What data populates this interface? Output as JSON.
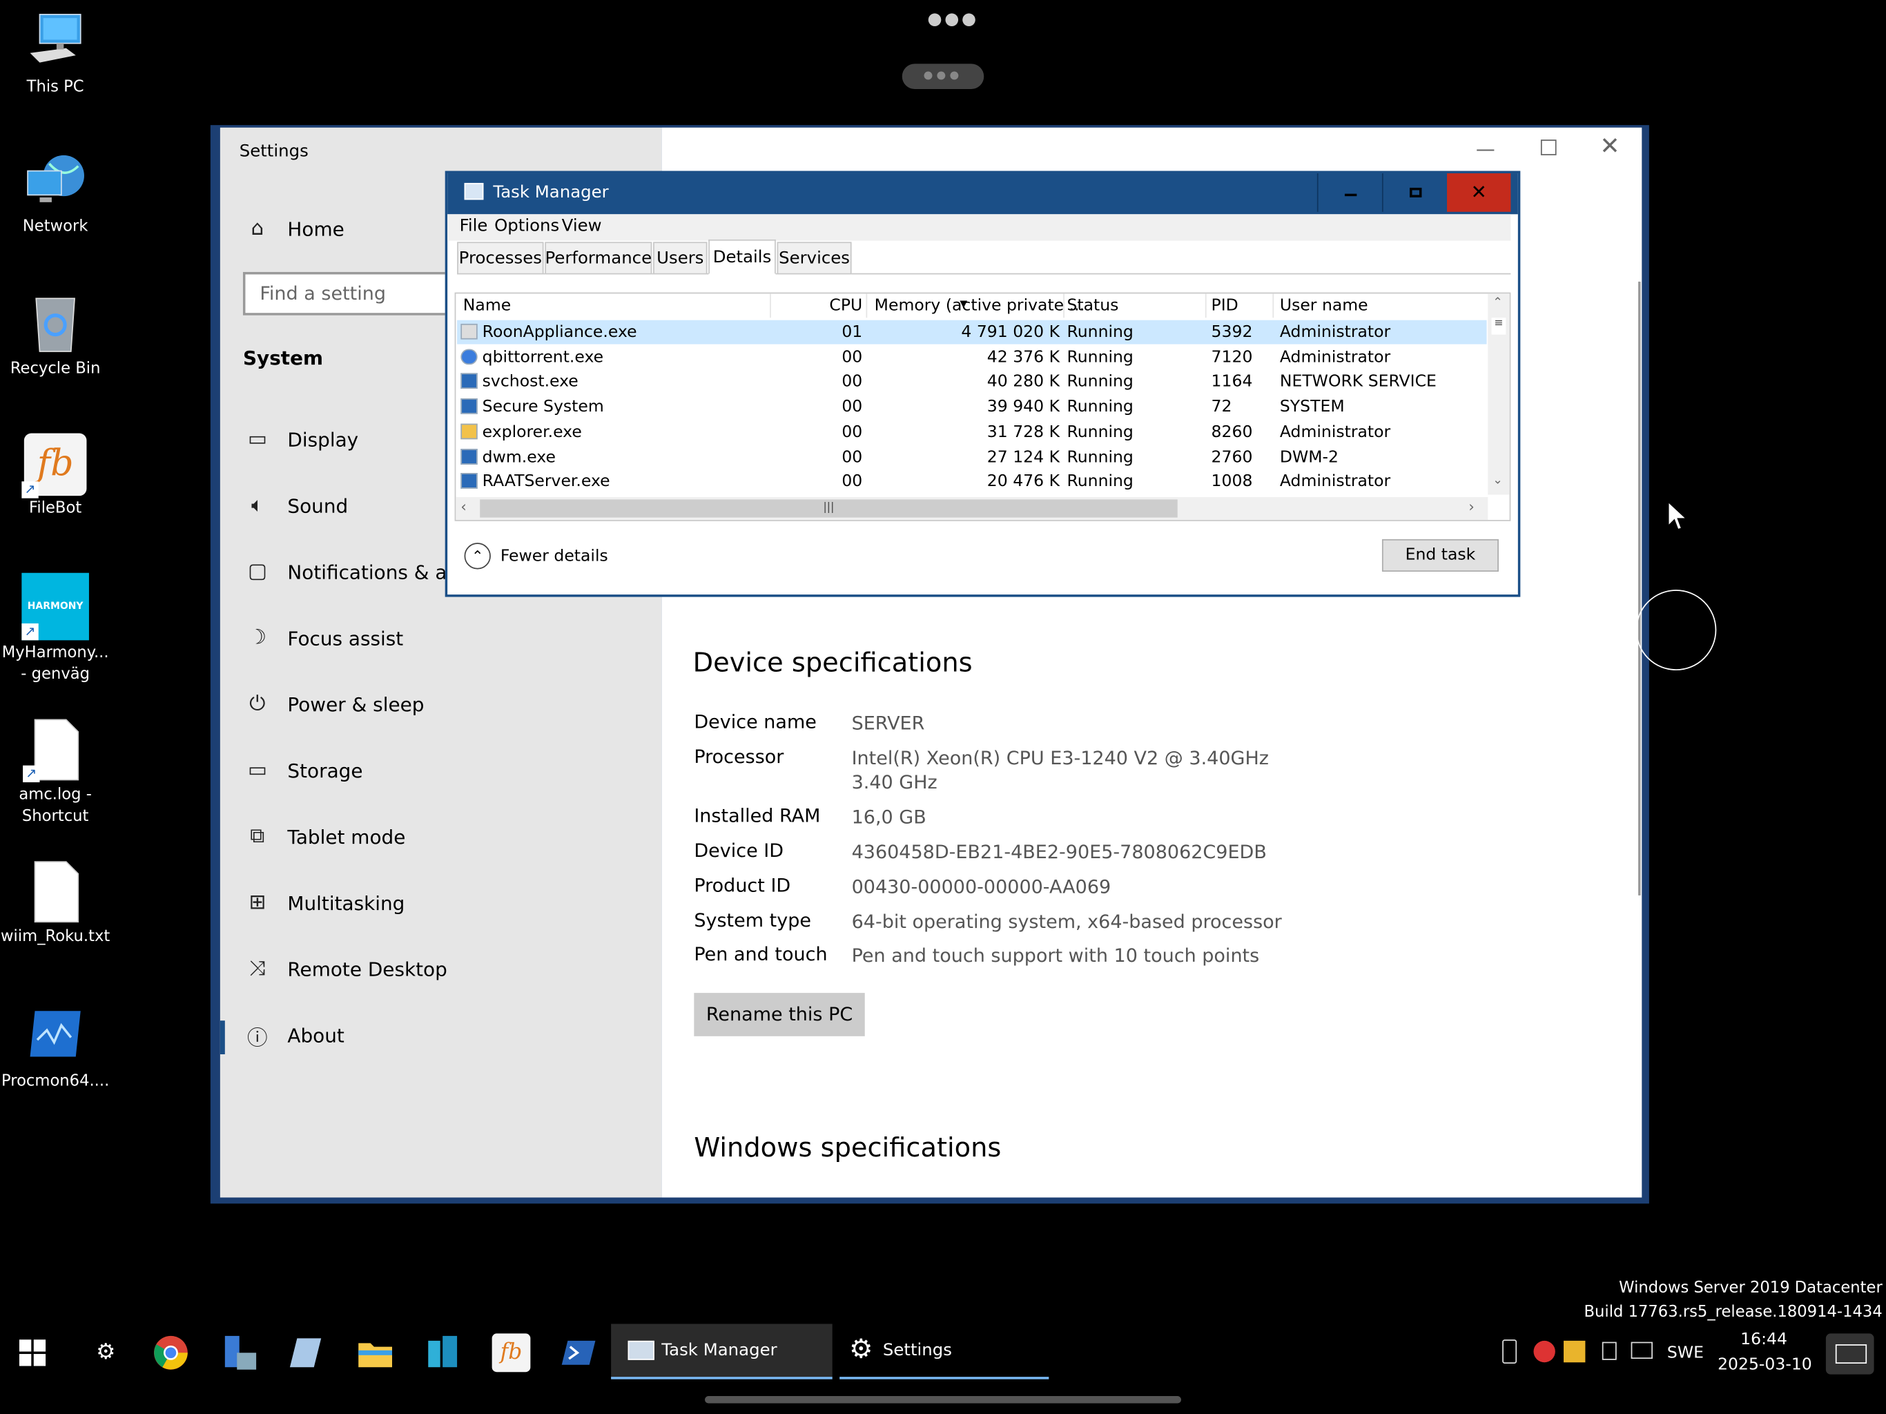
{
  "desktop": {
    "icons": [
      {
        "label_1": "This PC",
        "label_2": "",
        "icon": "this-pc-icon"
      },
      {
        "label_1": "Network",
        "label_2": "",
        "icon": "network-icon"
      },
      {
        "label_1": "Recycle Bin",
        "label_2": "",
        "icon": "recycle-bin-icon"
      },
      {
        "label_1": "FileBot",
        "label_2": "",
        "icon": "filebot-icon"
      },
      {
        "label_1": "MyHarmony...",
        "label_2": "- genväg",
        "icon": "harmony-icon"
      },
      {
        "label_1": "amc.log -",
        "label_2": "Shortcut",
        "icon": "file-shortcut-icon"
      },
      {
        "label_1": "wiim_Roku.txt",
        "label_2": "",
        "icon": "text-file-icon"
      },
      {
        "label_1": "Procmon64....",
        "label_2": "",
        "icon": "procmon-icon"
      }
    ],
    "harmony_text": "HARMONY",
    "filebot_text": "fb"
  },
  "settings": {
    "title": "Settings",
    "home": "Home",
    "search_placeholder": "Find a setting",
    "section": "System",
    "nav": [
      {
        "label": "Display",
        "icon": "display-icon"
      },
      {
        "label": "Sound",
        "icon": "sound-icon"
      },
      {
        "label": "Notifications & acti",
        "icon": "notifications-icon"
      },
      {
        "label": "Focus assist",
        "icon": "focus-assist-icon"
      },
      {
        "label": "Power & sleep",
        "icon": "power-icon"
      },
      {
        "label": "Storage",
        "icon": "storage-icon"
      },
      {
        "label": "Tablet mode",
        "icon": "tablet-mode-icon"
      },
      {
        "label": "Multitasking",
        "icon": "multitasking-icon"
      },
      {
        "label": "Remote Desktop",
        "icon": "remote-desktop-icon"
      },
      {
        "label": "About",
        "icon": "info-icon"
      }
    ],
    "selected": "About",
    "device_spec_heading": "Device specifications",
    "specs": [
      {
        "label": "Device name",
        "value": "SERVER"
      },
      {
        "label": "Processor",
        "value": "Intel(R) Xeon(R) CPU E3-1240 V2 @ 3.40GHz   3.40 GHz"
      },
      {
        "label": "Installed RAM",
        "value": "16,0 GB"
      },
      {
        "label": "Device ID",
        "value": "4360458D-EB21-4BE2-90E5-7808062C9EDB"
      },
      {
        "label": "Product ID",
        "value": "00430-00000-00000-AA069"
      },
      {
        "label": "System type",
        "value": "64-bit operating system, x64-based processor"
      },
      {
        "label": "Pen and touch",
        "value": "Pen and touch support with 10 touch points"
      }
    ],
    "rename_button": "Rename this PC",
    "windows_spec_heading": "Windows specifications"
  },
  "task_manager": {
    "title": "Task Manager",
    "menu": [
      "File",
      "Options",
      "View"
    ],
    "tabs": [
      "Processes",
      "Performance",
      "Users",
      "Details",
      "Services"
    ],
    "active_tab": "Details",
    "columns": [
      "Name",
      "CPU",
      "Memory (active private ...",
      "Status",
      "PID",
      "User name"
    ],
    "rows": [
      {
        "name": "RoonAppliance.exe",
        "cpu": "01",
        "memory": "4 791 020 K",
        "status": "Running",
        "pid": "5392",
        "user": "Administrator"
      },
      {
        "name": "qbittorrent.exe",
        "cpu": "00",
        "memory": "42 376 K",
        "status": "Running",
        "pid": "7120",
        "user": "Administrator"
      },
      {
        "name": "svchost.exe",
        "cpu": "00",
        "memory": "40 280 K",
        "status": "Running",
        "pid": "1164",
        "user": "NETWORK SERVICE"
      },
      {
        "name": "Secure System",
        "cpu": "00",
        "memory": "39 940 K",
        "status": "Running",
        "pid": "72",
        "user": "SYSTEM"
      },
      {
        "name": "explorer.exe",
        "cpu": "00",
        "memory": "31 728 K",
        "status": "Running",
        "pid": "8260",
        "user": "Administrator"
      },
      {
        "name": "dwm.exe",
        "cpu": "00",
        "memory": "27 124 K",
        "status": "Running",
        "pid": "2760",
        "user": "DWM-2"
      },
      {
        "name": "RAATServer.exe",
        "cpu": "00",
        "memory": "20 476 K",
        "status": "Running",
        "pid": "1008",
        "user": "Administrator"
      }
    ],
    "selected_row": 0,
    "fewer_details": "Fewer details",
    "end_task": "End task"
  },
  "watermark": {
    "line1": "Windows Server 2019 Datacenter",
    "line2": "Build 17763.rs5_release.180914-1434"
  },
  "taskbar": {
    "apps": [
      {
        "label": "Task Manager",
        "icon": "task-manager-icon"
      },
      {
        "label": "Settings",
        "icon": "gear-icon"
      }
    ],
    "language": "SWE",
    "time": "16:44",
    "date": "2025-03-10"
  },
  "colors": {
    "accent": "#1b4f87",
    "tm_close": "#c42b1c",
    "selected_row": "#cce8ff"
  }
}
